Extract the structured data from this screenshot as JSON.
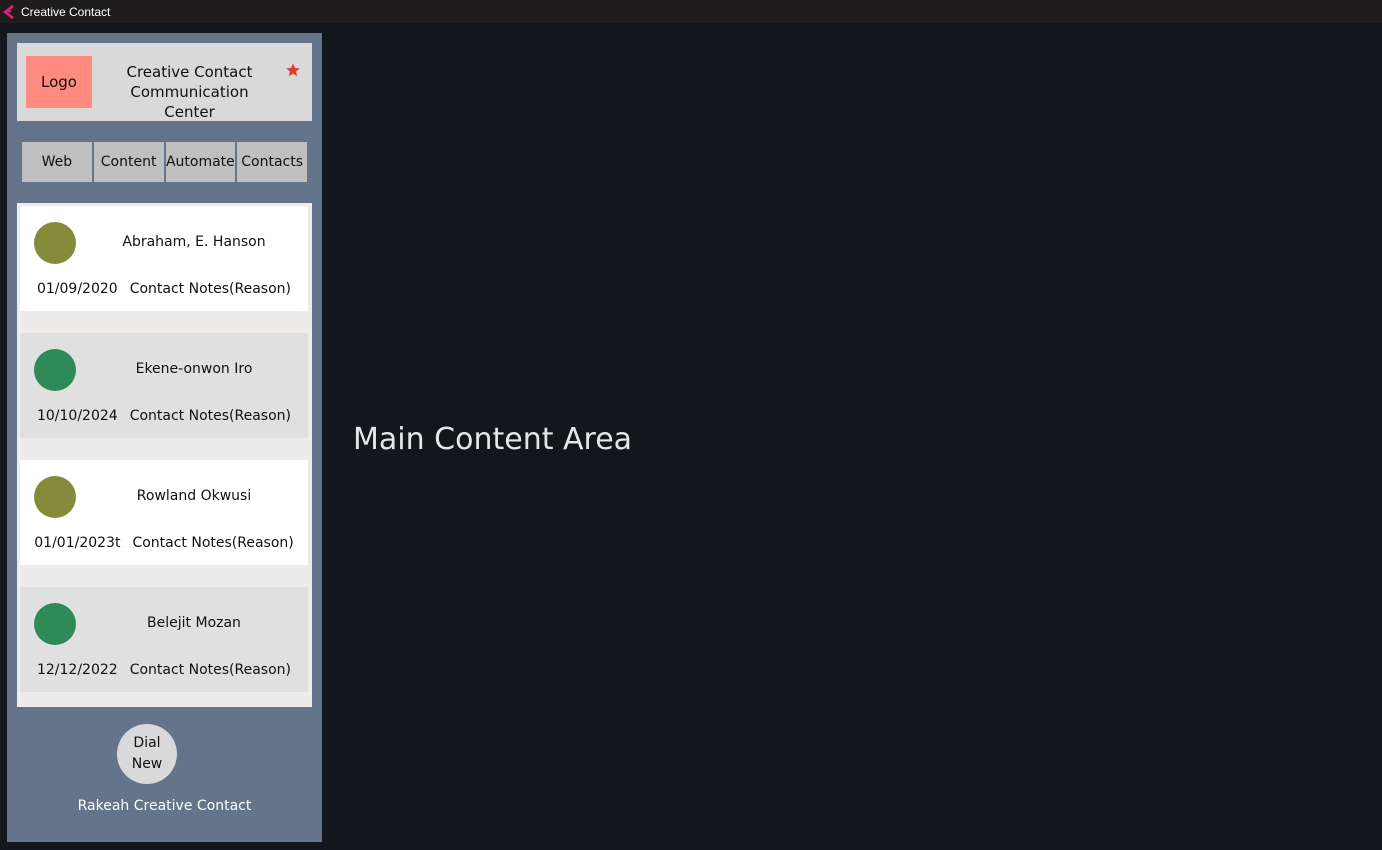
{
  "window": {
    "title": "Creative Contact",
    "icon": "flutter-icon"
  },
  "header": {
    "logo_text": "Logo",
    "app_name_line1": "Creative Contact",
    "app_name_line2": "Communication Center",
    "star_icon": "star-icon",
    "star_color": "#e53935"
  },
  "nav": {
    "tabs": [
      {
        "label": "Web"
      },
      {
        "label": "Content"
      },
      {
        "label": "Automate"
      },
      {
        "label": "Contacts"
      }
    ]
  },
  "contacts": [
    {
      "name": "Abraham, E. Hanson",
      "date": "01/09/2020",
      "notes": "Contact Notes(Reason)",
      "avatar_color": "#848b3a",
      "background": "white"
    },
    {
      "name": "Ekene-onwon Iro",
      "date": "10/10/2024",
      "notes": "Contact Notes(Reason)",
      "avatar_color": "#2e8b57",
      "background": "grey"
    },
    {
      "name": "Rowland Okwusi",
      "date": "01/01/2023t",
      "notes": "Contact Notes(Reason)",
      "avatar_color": "#848b3a",
      "background": "white"
    },
    {
      "name": "Belejit Mozan",
      "date": "12/12/2022",
      "notes": "Contact Notes(Reason)",
      "avatar_color": "#2e8b57",
      "background": "grey"
    }
  ],
  "dial": {
    "line1": "Dial",
    "line2": "New"
  },
  "footer": {
    "text": "Rakeah Creative Contact"
  },
  "main": {
    "placeholder": "Main Content Area"
  },
  "colors": {
    "sidebar": "#64748b",
    "background": "#13161b",
    "logo": "#ff8a80"
  }
}
